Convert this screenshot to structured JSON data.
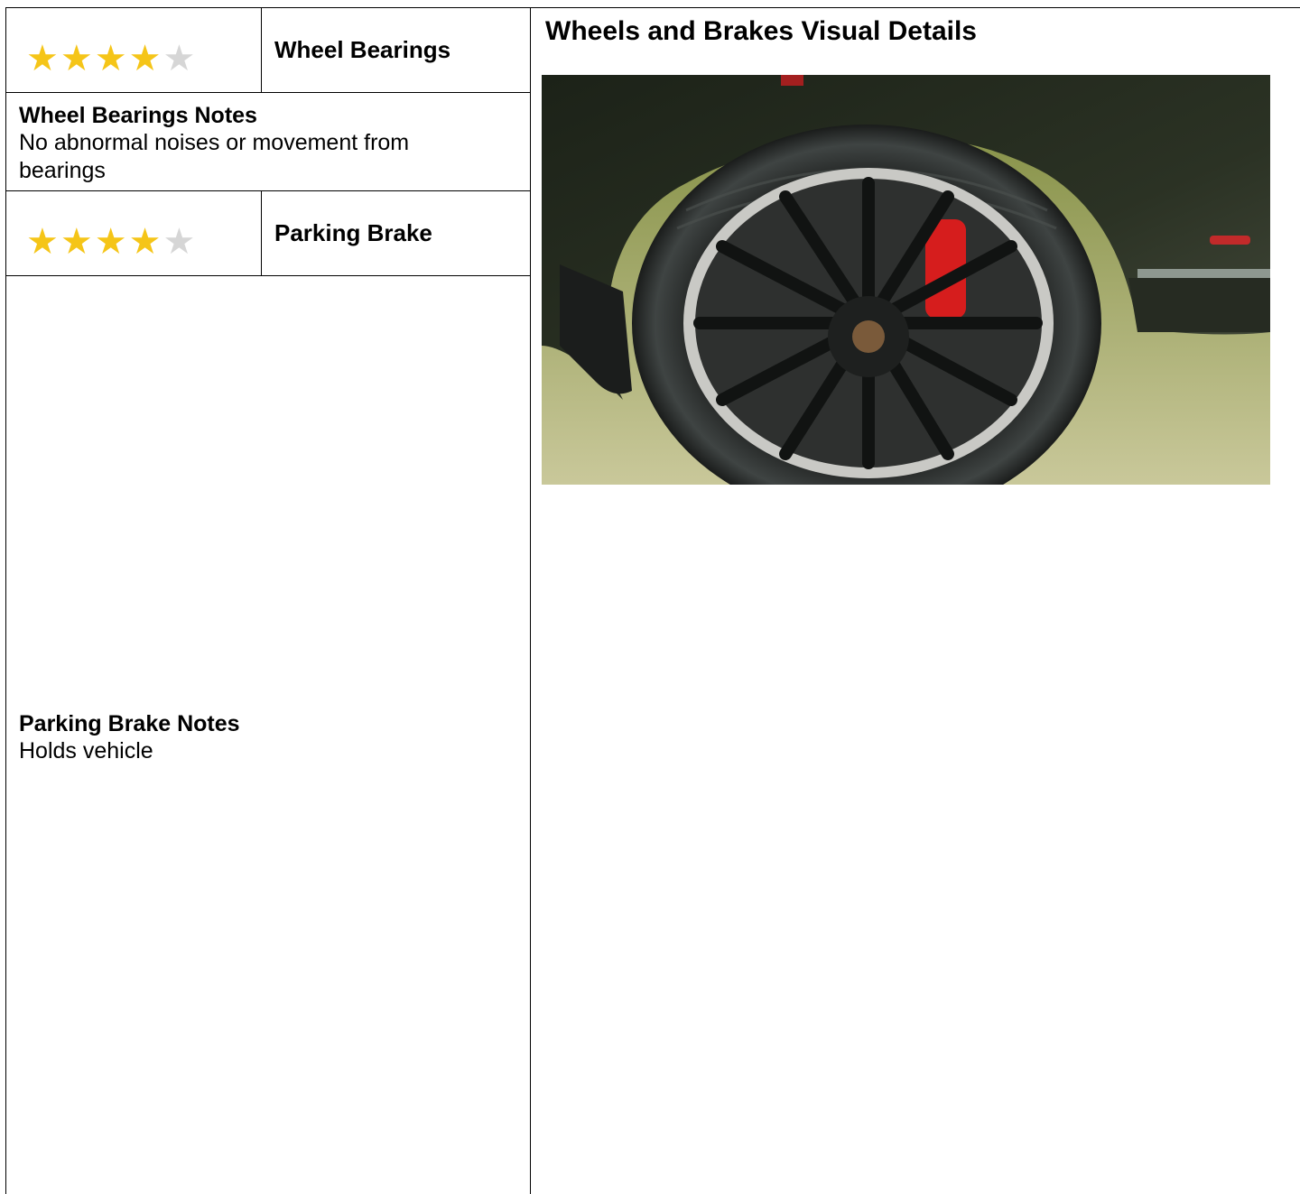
{
  "ratings": [
    {
      "label": "Wheel Bearings",
      "stars": 4,
      "max": 5
    },
    {
      "label": "Parking Brake",
      "stars": 4,
      "max": 5
    }
  ],
  "notes": {
    "wheel_bearings": {
      "title": "Wheel Bearings Notes",
      "text_line1": "No abnormal noises or movement from",
      "text_line2": "bearings"
    },
    "parking_brake": {
      "title": "Parking Brake Notes",
      "text": "Holds vehicle"
    }
  },
  "visual": {
    "title": "Wheels and Brakes Visual Details"
  },
  "colors": {
    "star_on": "#f5c518",
    "star_off": "#d6d6d6"
  }
}
